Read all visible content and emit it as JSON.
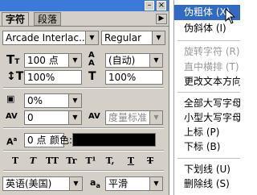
{
  "panel": {
    "tabs": [
      "字符",
      "段落"
    ],
    "font_family": "Arcade Interlac...",
    "font_style": "Regular",
    "font_size": "100 点",
    "leading": "(自动)",
    "vertical_scale": "100%",
    "horizontal_scale": "100%",
    "tsume": "0%",
    "kerning": "0",
    "tracking": "度量标准",
    "baseline_shift": "0 点",
    "color_label": "颜色:",
    "style_buttons": [
      "T",
      "T",
      "TT",
      "Tr",
      "T¹",
      "T,",
      "T",
      "T"
    ],
    "language": "英语(美国)",
    "antialias_label": "a",
    "antialias": "平滑",
    "antialias_prefix": "a"
  },
  "menu": {
    "items": [
      {
        "label": "伪粗体 (X)",
        "highlighted": true,
        "disabled": false
      },
      {
        "label": "伪斜体 (I)",
        "highlighted": false,
        "disabled": false
      },
      {
        "label": "旋转字符 (R)",
        "highlighted": false,
        "disabled": true
      },
      {
        "label": "直中横排 (T)",
        "highlighted": false,
        "disabled": true
      },
      {
        "label": "更改文本方向",
        "highlighted": false,
        "disabled": false
      },
      {
        "label": "全部大写字母",
        "highlighted": false,
        "disabled": false
      },
      {
        "label": "小型大写字母",
        "highlighted": false,
        "disabled": false
      },
      {
        "label": "上标 (P)",
        "highlighted": false,
        "disabled": false
      },
      {
        "label": "下标 (B)",
        "highlighted": false,
        "disabled": false
      },
      {
        "label": "下划线 (U)",
        "highlighted": false,
        "disabled": false
      },
      {
        "label": "删除线 (S)",
        "highlighted": false,
        "disabled": false
      }
    ]
  },
  "colors": {
    "title_blue": "#3b7ad8",
    "highlight": "#316ac5",
    "panel_bg": "#d4d0c8",
    "text_color_swatch": "#000000"
  }
}
